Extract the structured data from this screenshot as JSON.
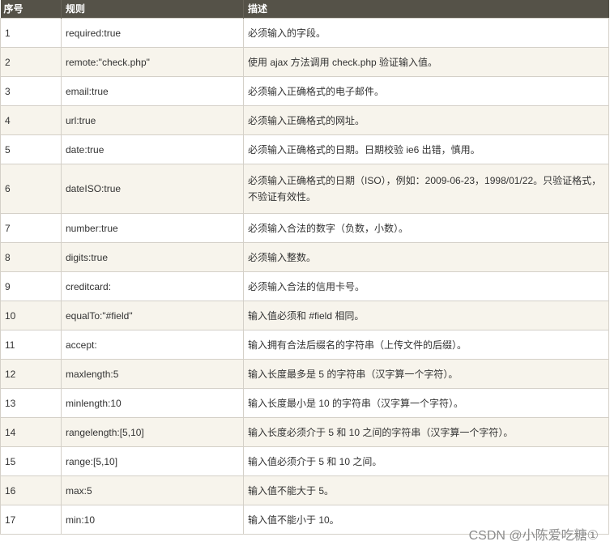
{
  "table": {
    "headers": {
      "num": "序号",
      "rule": "规则",
      "desc": "描述"
    },
    "rows": [
      {
        "num": "1",
        "rule": "required:true",
        "desc": "必须输入的字段。"
      },
      {
        "num": "2",
        "rule": "remote:\"check.php\"",
        "desc": "使用 ajax 方法调用 check.php 验证输入值。"
      },
      {
        "num": "3",
        "rule": "email:true",
        "desc": "必须输入正确格式的电子邮件。"
      },
      {
        "num": "4",
        "rule": "url:true",
        "desc": "必须输入正确格式的网址。"
      },
      {
        "num": "5",
        "rule": "date:true",
        "desc": "必须输入正确格式的日期。日期校验 ie6 出错，慎用。"
      },
      {
        "num": "6",
        "rule": "dateISO:true",
        "desc": "必须输入正确格式的日期（ISO），例如：2009-06-23，1998/01/22。只验证格式，不验证有效性。"
      },
      {
        "num": "7",
        "rule": "number:true",
        "desc": "必须输入合法的数字（负数，小数）。"
      },
      {
        "num": "8",
        "rule": "digits:true",
        "desc": "必须输入整数。"
      },
      {
        "num": "9",
        "rule": "creditcard:",
        "desc": "必须输入合法的信用卡号。"
      },
      {
        "num": "10",
        "rule": "equalTo:\"#field\"",
        "desc": "输入值必须和 #field 相同。"
      },
      {
        "num": "11",
        "rule": "accept:",
        "desc": "输入拥有合法后缀名的字符串（上传文件的后缀）。"
      },
      {
        "num": "12",
        "rule": "maxlength:5",
        "desc": "输入长度最多是 5 的字符串（汉字算一个字符）。"
      },
      {
        "num": "13",
        "rule": "minlength:10",
        "desc": "输入长度最小是 10 的字符串（汉字算一个字符）。"
      },
      {
        "num": "14",
        "rule": "rangelength:[5,10]",
        "desc": "输入长度必须介于 5 和 10 之间的字符串（汉字算一个字符）。"
      },
      {
        "num": "15",
        "rule": "range:[5,10]",
        "desc": "输入值必须介于 5 和 10 之间。"
      },
      {
        "num": "16",
        "rule": "max:5",
        "desc": "输入值不能大于 5。"
      },
      {
        "num": "17",
        "rule": "min:10",
        "desc": "输入值不能小于 10。"
      }
    ]
  },
  "watermark": "CSDN @小陈爱吃糖①"
}
